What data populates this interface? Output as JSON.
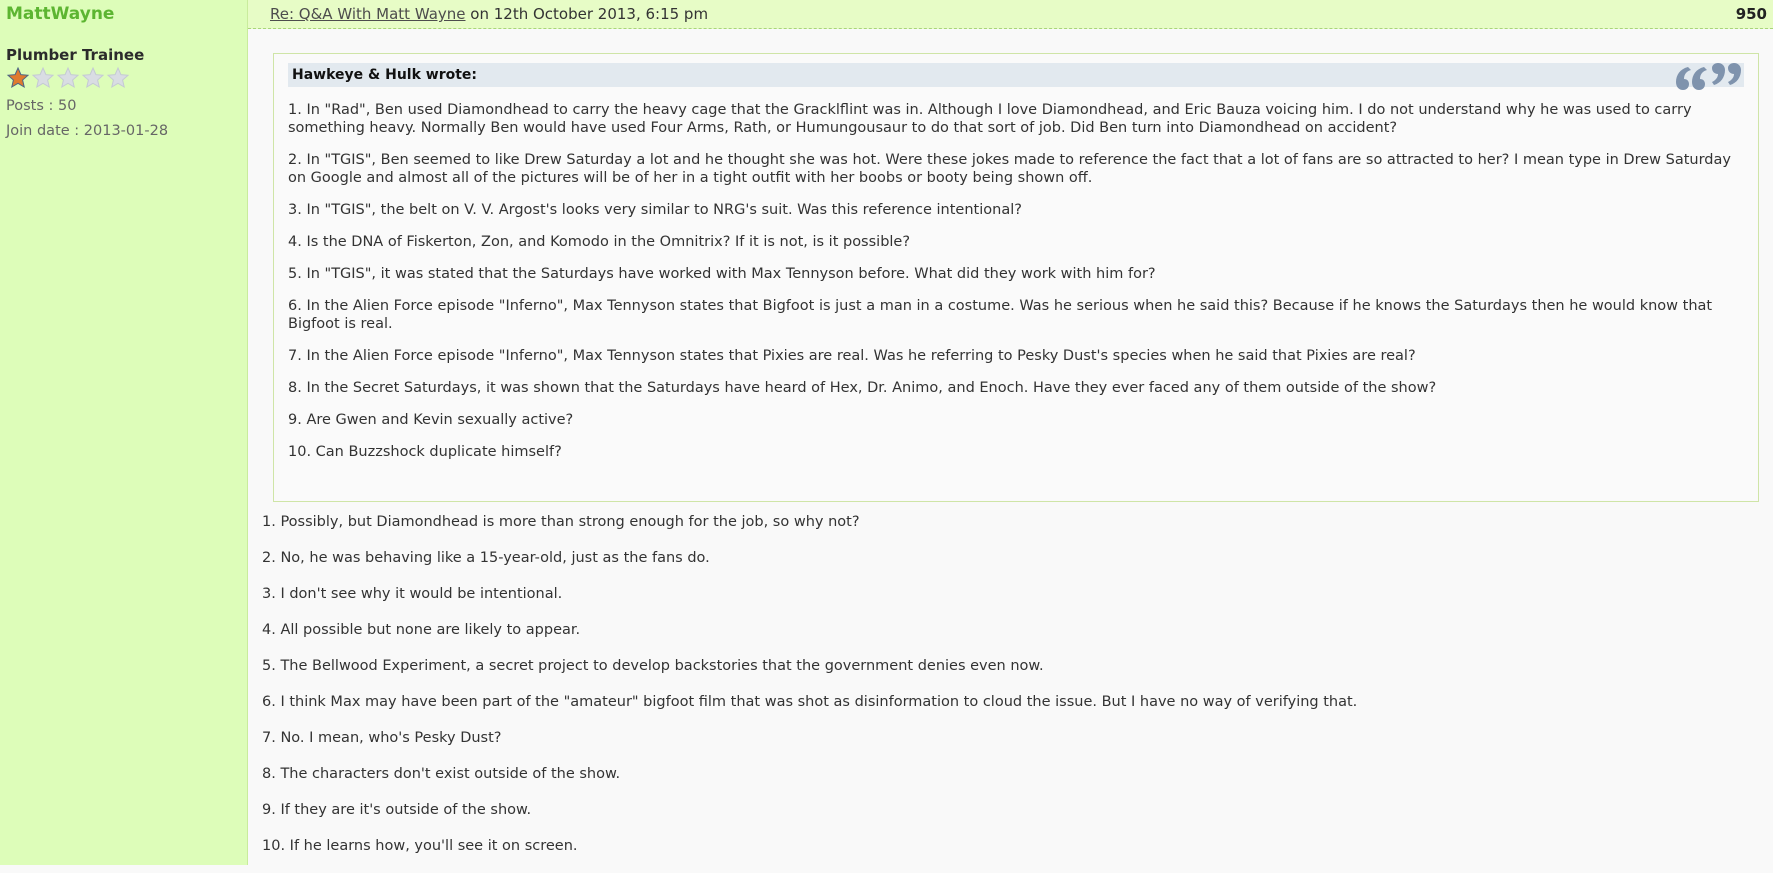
{
  "user": {
    "name": "MattWayne",
    "rank": "Plumber Trainee",
    "rating": 1,
    "rating_max": 5,
    "posts": "Posts : 50",
    "join_date": "Join date : 2013-01-28"
  },
  "post": {
    "title_link": "Re: Q&A With Matt Wayne",
    "date": "on 12th October 2013, 6:15 pm",
    "number": "950"
  },
  "quote": {
    "author": "Hawkeye & Hulk wrote:",
    "lines": [
      "1. In \"Rad\", Ben used Diamondhead to carry the heavy cage that the Gracklflint was in. Although I love Diamondhead, and Eric Bauza voicing him. I do not understand why he was used to carry something heavy. Normally Ben would have used Four Arms, Rath, or Humungousaur to do that sort of job. Did Ben turn into Diamondhead on accident?",
      "2. In \"TGIS\", Ben seemed to like Drew Saturday a lot and he thought she was hot. Were these jokes made to reference the fact that a lot of fans are so attracted to her? I mean type in Drew Saturday on Google and almost all of the pictures will be of her in a tight outfit with her boobs or booty being shown off.",
      "3. In \"TGIS\", the belt on V. V. Argost's looks very similar to NRG's suit. Was this reference intentional?",
      "4. Is the DNA of Fiskerton, Zon, and Komodo in the Omnitrix? If it is not, is it possible?",
      "5. In \"TGIS\", it was stated that the Saturdays have worked with Max Tennyson before. What did they work with him for?",
      "6. In the Alien Force episode \"Inferno\", Max Tennyson states that Bigfoot is just a man in a costume. Was he serious when he said this? Because if he knows the Saturdays then he would know that Bigfoot is real.",
      "7. In the Alien Force episode \"Inferno\", Max Tennyson states that Pixies are real. Was he referring to Pesky Dust's species when he said that Pixies are real?",
      "8. In the Secret Saturdays, it was shown that the Saturdays have heard of Hex, Dr. Animo, and Enoch. Have they ever faced any of them outside of the show?",
      "9. Are Gwen and Kevin sexually active?",
      "10. Can Buzzshock duplicate himself?"
    ]
  },
  "answers": [
    "1. Possibly, but Diamondhead is more than strong enough for the job, so why not?",
    "2. No, he was behaving like a 15-year-old, just as the fans do.",
    "3. I don't see why it would be intentional.",
    "4. All possible but none are likely to appear.",
    "5. The Bellwood Experiment, a secret project to develop backstories that the government denies even now.",
    "6. I think Max may have been part of the \"amateur\" bigfoot film that was shot as disinformation to cloud the issue. But I have no way of verifying that.",
    "7. No. I mean, who's Pesky Dust?",
    "8. The characters don't exist outside of the show.",
    "9. If they are it's outside of the show.",
    "10. If he learns how, you'll see it on screen."
  ],
  "icons": {
    "star": "star-icon",
    "quote": "quote-icon"
  },
  "colors": {
    "username": "#5cb531",
    "sidebar_bg": "#ddfdb9",
    "header_bg": "#e7fcc6",
    "quote_head_bg": "#e2e9ef",
    "star_filled": "#e07a2e",
    "quote_icon": "#7f93ad"
  }
}
